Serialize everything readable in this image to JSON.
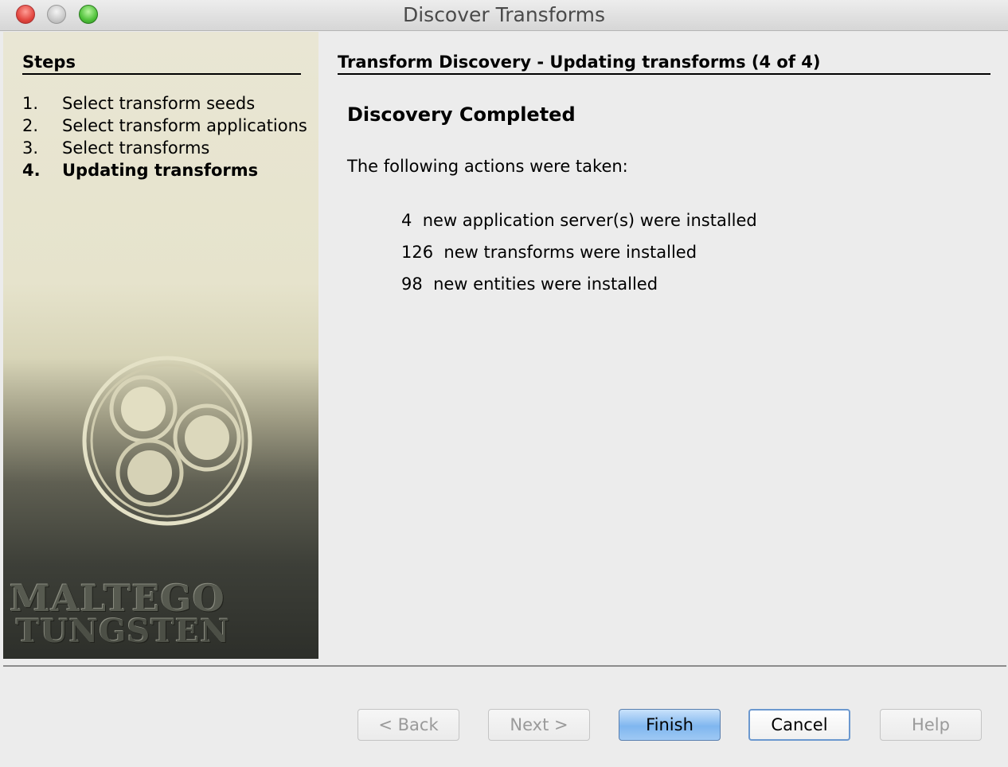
{
  "window": {
    "title": "Discover Transforms"
  },
  "sidebar": {
    "heading": "Steps",
    "steps": [
      {
        "num": "1.",
        "label": "Select transform seeds"
      },
      {
        "num": "2.",
        "label": "Select transform applications"
      },
      {
        "num": "3.",
        "label": "Select transforms"
      },
      {
        "num": "4.",
        "label": "Updating transforms"
      }
    ],
    "active_step": 4,
    "brand": {
      "line1": "MALTEGO",
      "line2": "TUNGSTEN"
    }
  },
  "main": {
    "heading": "Transform Discovery - Updating transforms (4 of 4)",
    "status": "Discovery Completed",
    "intro": "The following actions were taken:",
    "actions": [
      "4  new application server(s) were installed",
      "126  new transforms were installed",
      "98  new entities were installed"
    ]
  },
  "buttons": {
    "back": "< Back",
    "next": "Next >",
    "finish": "Finish",
    "cancel": "Cancel",
    "help": "Help"
  },
  "colors": {
    "default_button": "#7fb6ef",
    "focus_border": "#6b98cf",
    "disabled_text": "#9a9a9a"
  }
}
